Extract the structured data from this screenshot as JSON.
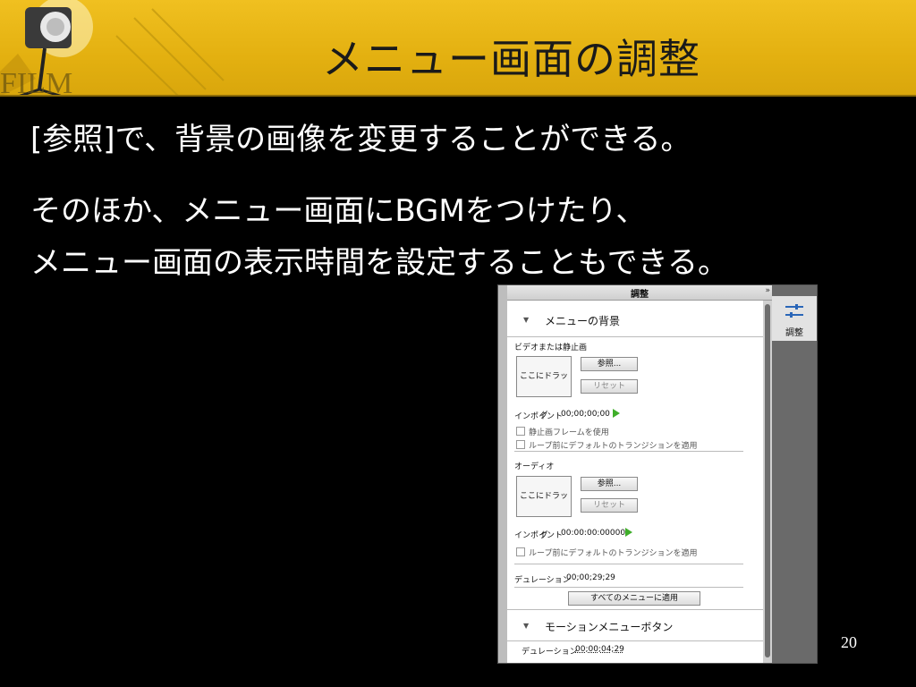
{
  "slide": {
    "title": "メニュー画面の調整",
    "lines": [
      "[参照]で、背景の画像を変更することができる。",
      "そのほか、メニュー画面にBGMをつけたり、",
      "メニュー画面の表示時間を設定することもできる。"
    ],
    "page_number": "20"
  },
  "panel": {
    "title": "調整",
    "collapse_arrows": "»",
    "side_tab_label": "調整",
    "side_tab_icon": "sliders-icon",
    "section1": {
      "label": "メニューの背景",
      "video_label": "ビデオまたは静止画",
      "drop_label": "ここにドラッグ",
      "browse": "参照...",
      "reset": "リセット",
      "inpoint_label": "インポイント",
      "inpoint_value": "00;00;00;00",
      "still_frame": "静止画フレームを使用",
      "default_transition": "ループ前にデフォルトのトランジションを適用",
      "audio_label": "オーディオ",
      "audio_drop_label": "ここにドラッグ",
      "audio_browse": "参照...",
      "audio_reset": "リセット",
      "audio_inpoint_label": "インポイント",
      "audio_inpoint_value": "00:00:00:00000",
      "audio_default_transition": "ループ前にデフォルトのトランジションを適用",
      "duration_label": "デュレーション",
      "duration_value": "00;00;29;29",
      "apply_all": "すべてのメニューに適用"
    },
    "section2": {
      "label": "モーションメニューボタン",
      "duration_label": "デュレーション",
      "duration_value": "00;00;04;29"
    }
  }
}
